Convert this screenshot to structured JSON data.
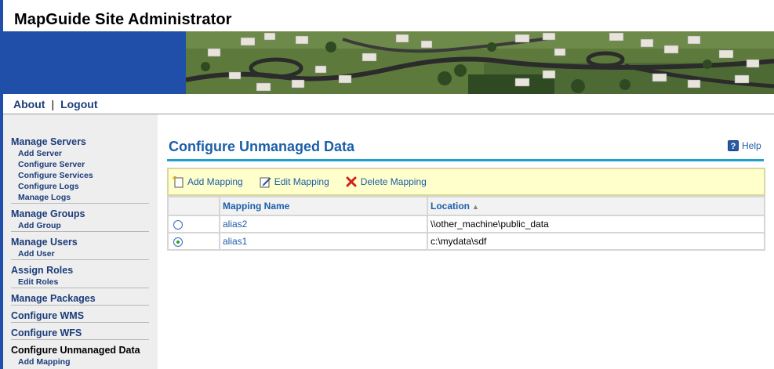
{
  "app": {
    "title": "MapGuide Site Administrator"
  },
  "topnav": {
    "about": "About",
    "separator": "|",
    "logout": "Logout"
  },
  "sidebar": {
    "manage_servers": {
      "title": "Manage Servers",
      "items": [
        "Add Server",
        "Configure Server",
        "Configure Services",
        "Configure Logs",
        "Manage Logs"
      ]
    },
    "manage_groups": {
      "title": "Manage Groups",
      "items": [
        "Add Group"
      ]
    },
    "manage_users": {
      "title": "Manage Users",
      "items": [
        "Add User"
      ]
    },
    "assign_roles": {
      "title": "Assign Roles",
      "items": [
        "Edit Roles"
      ]
    },
    "manage_packages": {
      "title": "Manage Packages"
    },
    "configure_wms": {
      "title": "Configure WMS"
    },
    "configure_wfs": {
      "title": "Configure WFS"
    },
    "configure_unmanaged": {
      "title": "Configure Unmanaged Data",
      "items": [
        "Add Mapping"
      ]
    }
  },
  "page": {
    "title": "Configure Unmanaged Data",
    "help": "Help"
  },
  "toolbar": {
    "add": "Add Mapping",
    "edit": "Edit Mapping",
    "delete": "Delete Mapping"
  },
  "table": {
    "columns": [
      "",
      "Mapping Name",
      "Location"
    ],
    "sort_indicator": "▲",
    "rows": [
      {
        "name": "alias2",
        "location": "\\\\other_machine\\public_data",
        "selected": false
      },
      {
        "name": "alias1",
        "location": "c:\\mydata\\sdf",
        "selected": true
      }
    ]
  },
  "colors": {
    "brand_blue": "#1f4fa8",
    "link_blue": "#1b5ea8",
    "toolbar_bg": "#ffffcc",
    "title_rule": "#1e9fd0"
  }
}
